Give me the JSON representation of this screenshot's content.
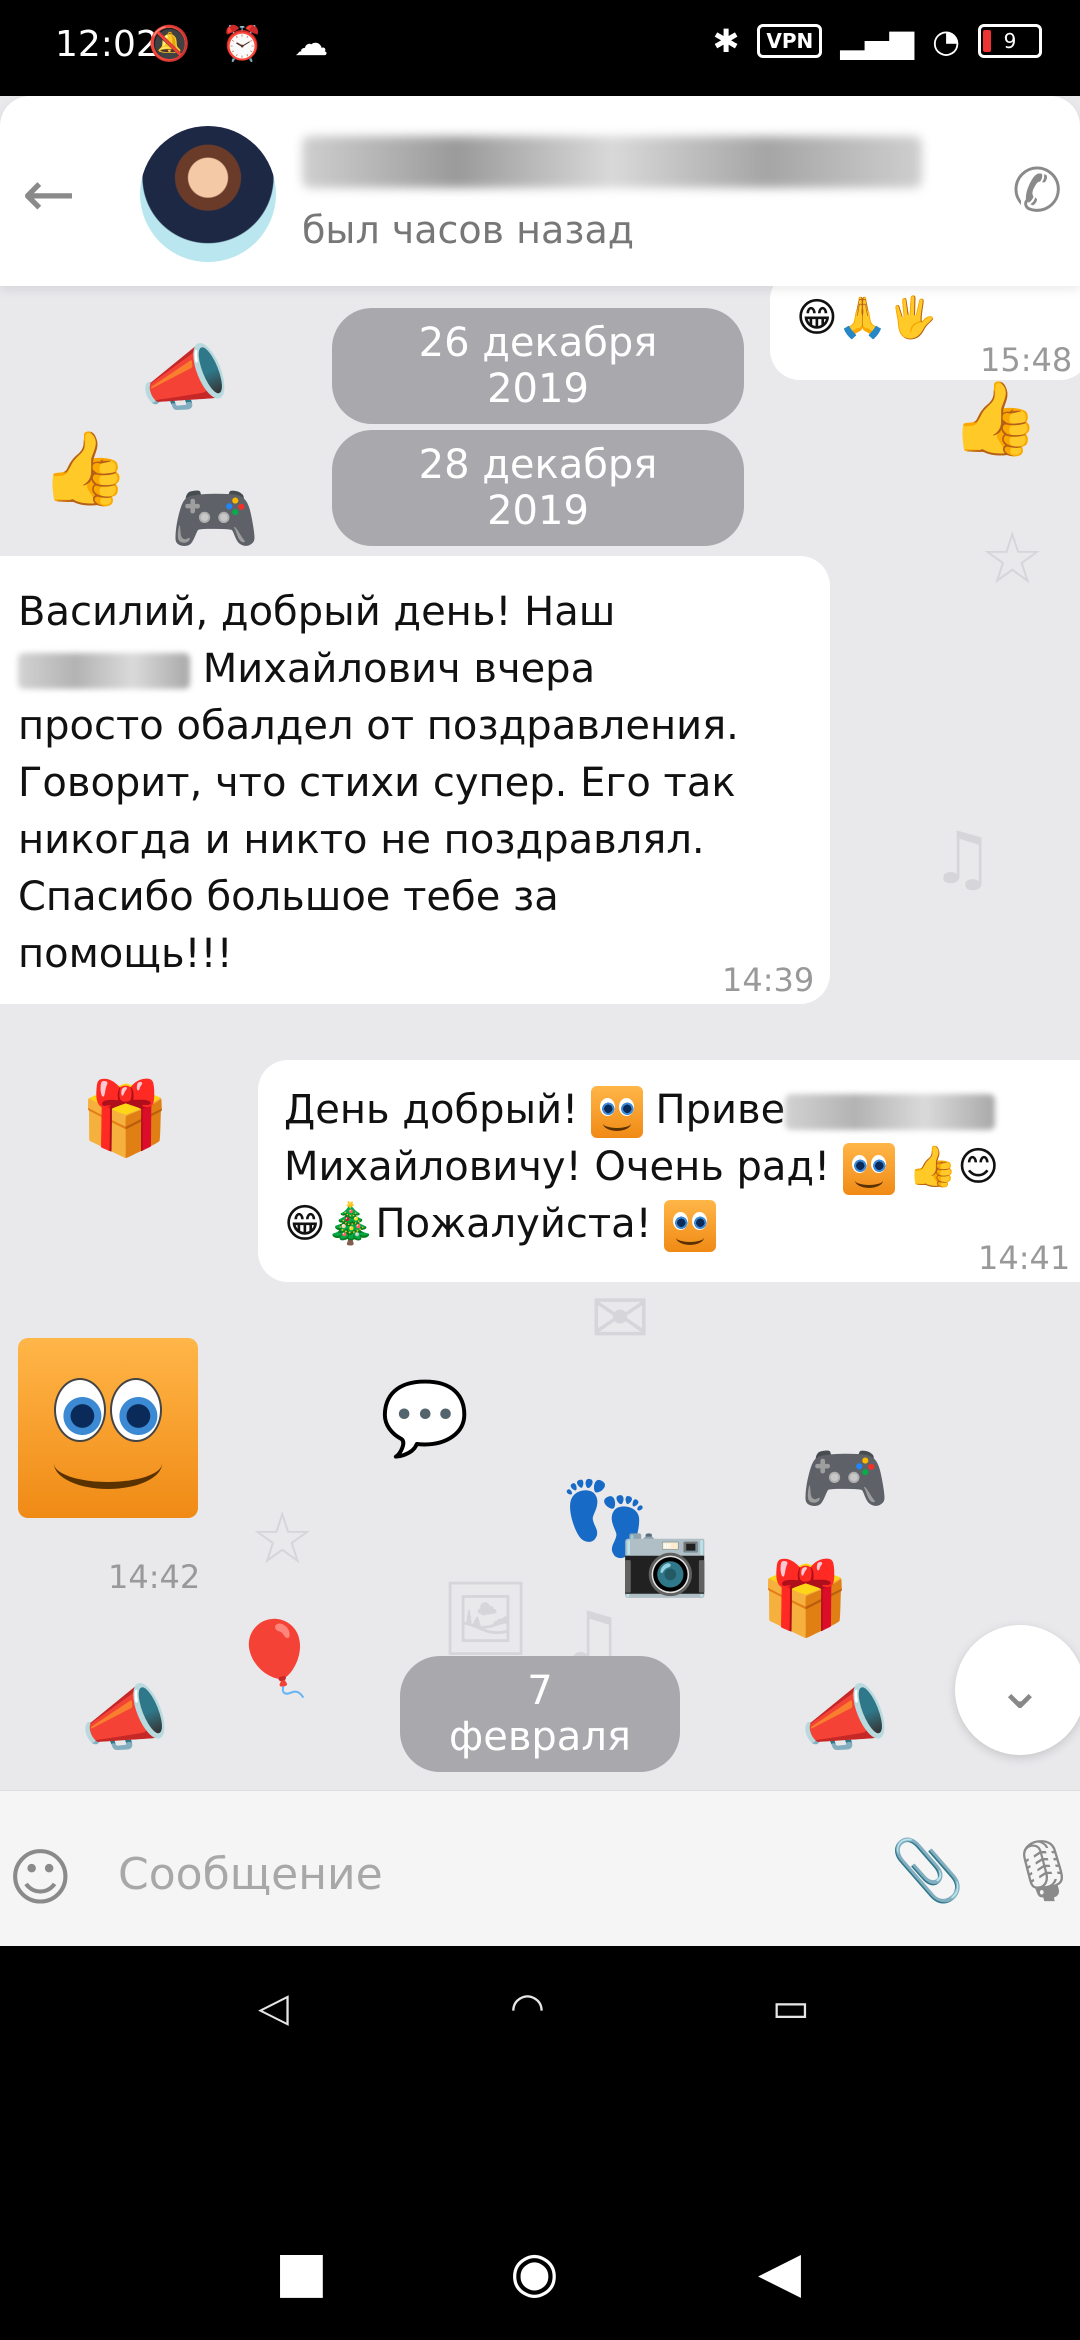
{
  "status_bar": {
    "time": "12:02",
    "left_icons": "🔕 ⏰ ☁",
    "bluetooth": "✱",
    "vpn": "VPN",
    "signal": "▂▄▆",
    "wifi": "◔",
    "battery": "9"
  },
  "header": {
    "back_icon": "arrow-left-icon",
    "contact_name": "",
    "last_seen": "был   часов назад",
    "call_icon": "phone-icon"
  },
  "chat": {
    "partial_reaction": "😁🙏🖐",
    "partial_time": "15:48",
    "date_1": "26 декабря 2019",
    "date_2": "28 декабря 2019",
    "incoming_1": {
      "line_1": "Василий, добрый день! Наш",
      "line_2": "Михайлович вчера",
      "line_3": "просто обалдел от поздравления.",
      "line_4": "Говорит, что стихи супер. Его так",
      "line_5": "никогда и никто не поздравлял.",
      "line_6": "Спасибо большое тебе за",
      "line_7": "помощь!!!",
      "time": "14:39"
    },
    "outgoing_1": {
      "part_a": "День добрый!",
      "part_b": "Приве",
      "part_c": "Михайловичу! Очень рад!",
      "part_d": "👍😊",
      "part_e": "😁🎄Пожалуйста!",
      "time": "14:41"
    },
    "sticker_time": "14:42",
    "date_3": "7 февраля",
    "scroll_down_icon": "chevron-down-icon"
  },
  "composer": {
    "placeholder": "Сообщение",
    "emoji_icon": "smiley-icon",
    "attach_icon": "paperclip-icon",
    "mic_icon": "microphone-icon"
  },
  "nav": {
    "square": "■",
    "circle": "◉",
    "back": "◀"
  }
}
